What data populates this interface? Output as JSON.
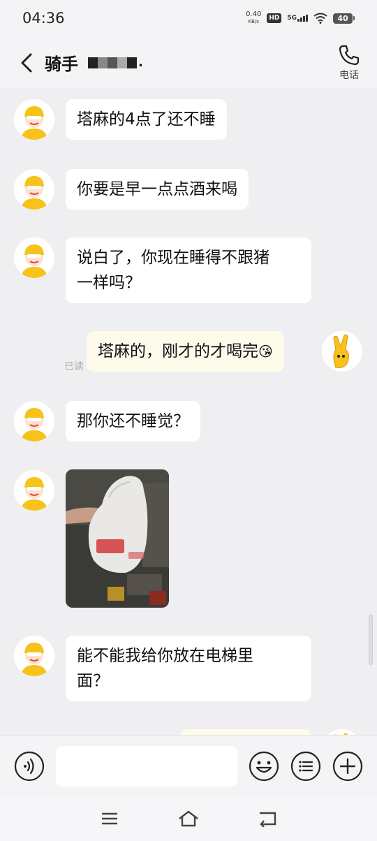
{
  "status": {
    "time": "04:36",
    "net_speed_value": "0.40",
    "net_speed_unit": "KB/s",
    "hd": "HD",
    "network": "5G",
    "battery": "40"
  },
  "header": {
    "title": "骑手",
    "call_label": "电话",
    "redacted_trailing": "."
  },
  "messages": [
    {
      "side": "left",
      "text": "塔麻的4点了还不睡"
    },
    {
      "side": "left",
      "text": "你要是早一点点酒来喝"
    },
    {
      "side": "left",
      "text_line1": "说白了，你现在睡得不跟猪",
      "text_line2": "一样吗？"
    },
    {
      "side": "right",
      "text": "塔麻的，刚才的才喝完",
      "read_status": "已读",
      "emoji": "😘"
    },
    {
      "side": "left",
      "text": "那你还不睡觉？"
    },
    {
      "side": "left",
      "type": "image"
    },
    {
      "side": "left",
      "text_line1": "能不能我给你放在电梯里",
      "text_line2": "面？"
    }
  ],
  "input": {
    "value": "",
    "placeholder": ""
  },
  "icons": {
    "back": "back-arrow-icon",
    "call": "phone-icon",
    "voice": "voice-icon",
    "emoji": "emoji-icon",
    "more_list": "list-menu-icon",
    "plus": "plus-icon",
    "nav_menu": "menu-icon",
    "nav_home": "home-icon",
    "nav_back": "nav-back-icon"
  },
  "colors": {
    "background": "#efeff1",
    "incoming_bubble": "#ffffff",
    "outgoing_bubble": "#fffbeb",
    "avatar_yellow": "#f7c21a"
  }
}
